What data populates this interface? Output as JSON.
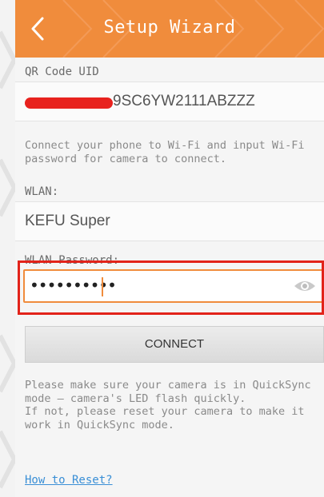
{
  "header": {
    "title": "Setup Wizard"
  },
  "qr": {
    "label": "QR Code UID",
    "uid_suffix": "9SC6YW2111ABZZZ"
  },
  "hint": "Connect your phone to Wi-Fi and input Wi-Fi password for camera to connect.",
  "wlan": {
    "label": "WLAN:",
    "value": "KEFU Super"
  },
  "password": {
    "label": "WLAN Password:",
    "masked_value": "••••••••••"
  },
  "connect_button": "CONNECT",
  "note": "Please make sure your camera is in QuickSync mode — camera's LED flash quickly.\nIf not, please reset your camera to make it work in QuickSync mode.",
  "reset_link": "How to Reset?",
  "colors": {
    "accent": "#f08c3c",
    "highlight": "#e2231a",
    "link": "#3a8fd6"
  },
  "icons": {
    "back": "chevron-left-icon",
    "eye": "eye-icon"
  }
}
